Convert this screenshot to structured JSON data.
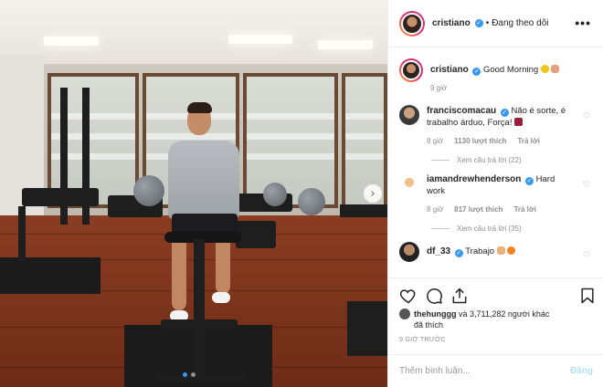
{
  "header": {
    "username": "cristiano",
    "separator": "•",
    "follow_status": "Đang theo dõi",
    "more": "•••"
  },
  "caption": {
    "username": "cristiano",
    "text": "Good Morning",
    "time": "9 giờ"
  },
  "comments": [
    {
      "username": "franciscomacau",
      "text": "Não é sorte, é trabalho árduo, Força!",
      "time": "8 giờ",
      "likes": "1130 lượt thích",
      "reply": "Trả lời",
      "view_replies": "Xem câu trả lời (22)"
    },
    {
      "username": "iamandrewhenderson",
      "text": "Hard work",
      "time": "8 giờ",
      "likes": "817 lượt thích",
      "reply": "Trả lời",
      "view_replies": "Xem câu trả lời (35)"
    },
    {
      "username": "df_33",
      "text": "Trabajo"
    }
  ],
  "likes_summary": {
    "user": "thehunggg",
    "rest": "và 3,711,282 người khác",
    "suffix": "đã thích"
  },
  "post_time": "9 GIỜ TRƯỚC",
  "add_comment": {
    "placeholder": "Thêm bình luận...",
    "post_label": "Đăng"
  },
  "colors": {
    "verified": "#3897f0",
    "post_disabled": "#b2dffc",
    "muted": "#8e8e8e"
  },
  "icons": [
    "heart-icon",
    "comment-icon",
    "share-icon",
    "bookmark-icon",
    "chevron-right-icon",
    "more-icon"
  ]
}
